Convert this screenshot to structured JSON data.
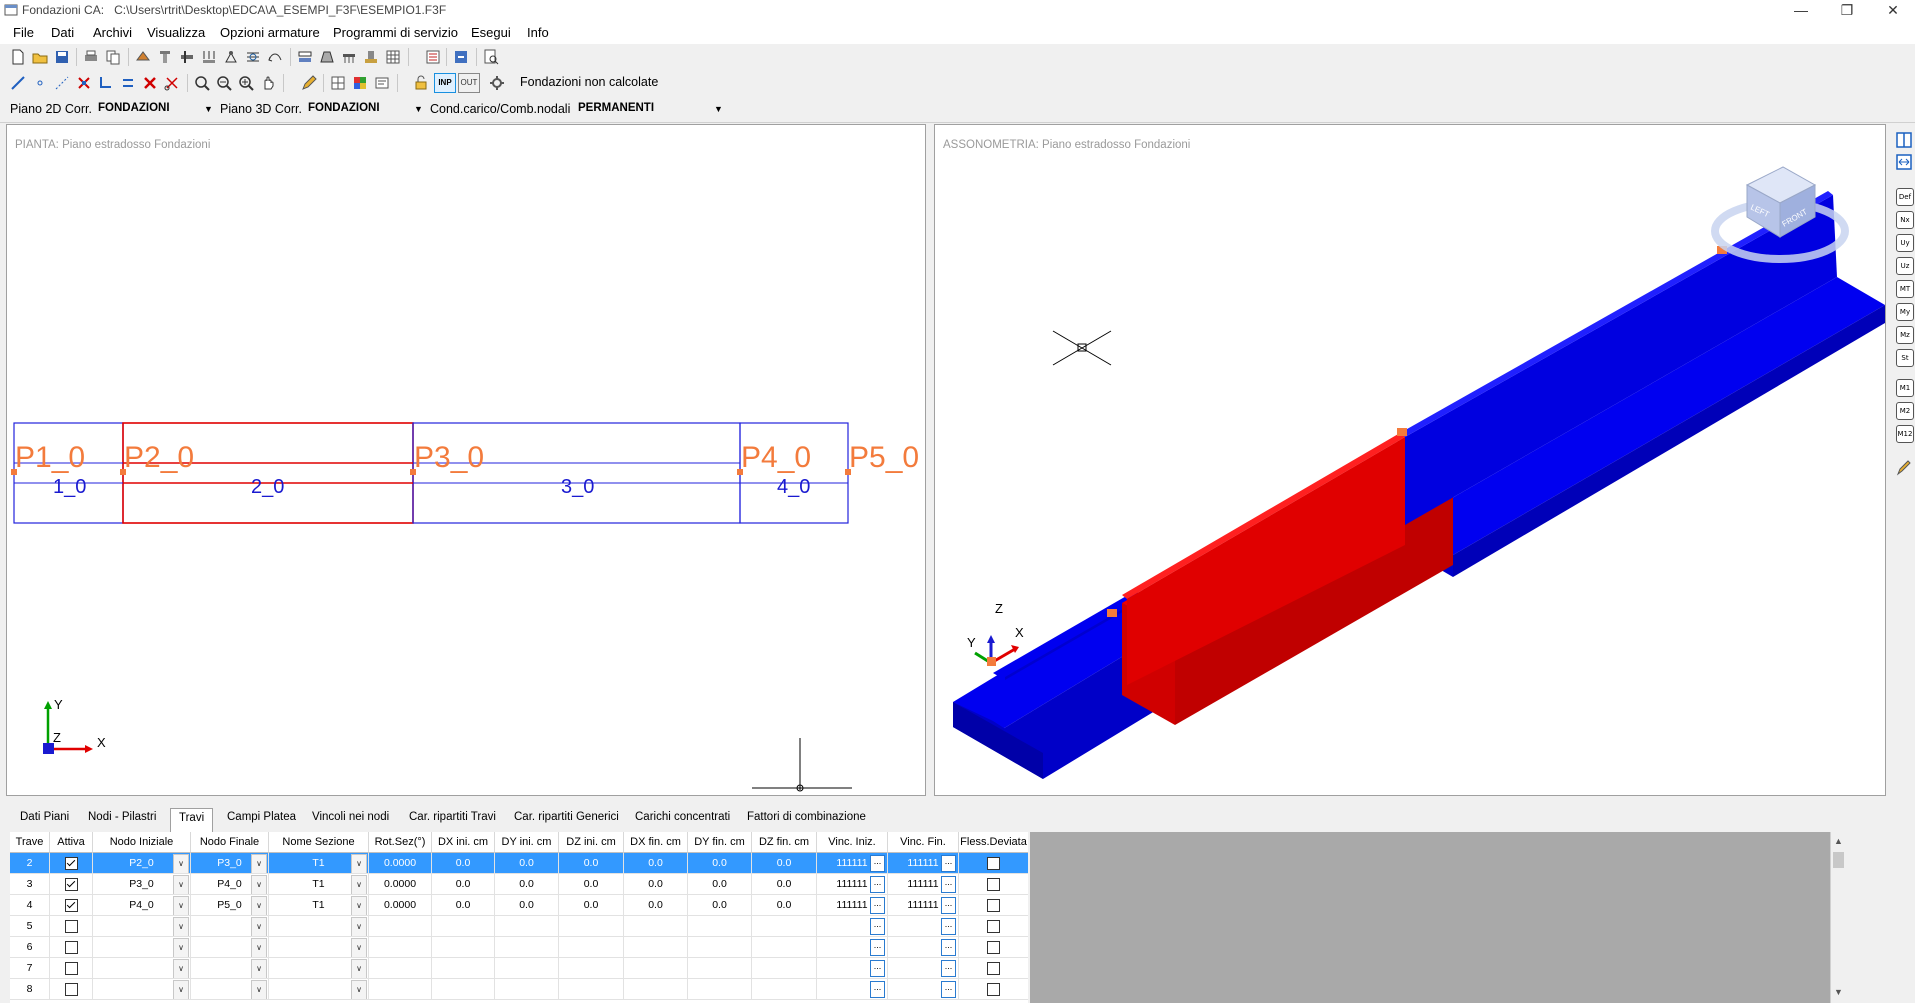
{
  "window": {
    "title": "Fondazioni CA:",
    "path": "C:\\Users\\rtrit\\Desktop\\EDCA\\A_ESEMPI_F3F\\ESEMPIO1.F3F",
    "controls": [
      "—",
      "❐",
      "✕"
    ]
  },
  "menu": [
    "File",
    "Dati",
    "Archivi",
    "Visualizza",
    "Opzioni armature",
    "Programmi di servizio",
    "Esegui",
    "Info"
  ],
  "toolbar2": {
    "status": "Fondazioni non calcolate",
    "inp": "INP",
    "out": "OUT"
  },
  "selectors": {
    "plane2d_label": "Piano 2D Corr.",
    "plane2d_value": "FONDAZIONI",
    "plane3d_label": "Piano 3D Corr.",
    "plane3d_value": "FONDAZIONI",
    "load_label": "Cond.carico/Comb.nodali",
    "load_value": "PERMANENTI"
  },
  "plan": {
    "caption": "PIANTA: Piano estradosso Fondazioni",
    "nodes": [
      "P1_0",
      "P2_0",
      "P3_0",
      "P4_0",
      "P5_0"
    ],
    "beams": [
      "1_0",
      "2_0",
      "3_0",
      "4_0"
    ],
    "axes": {
      "x": "X",
      "y": "Y",
      "z": "Z"
    }
  },
  "iso": {
    "caption": "ASSONOMETRIA: Piano estradosso Fondazioni",
    "cube_left": "LEFT",
    "cube_front": "FRONT",
    "axes": {
      "x": "X",
      "y": "Y",
      "z": "Z"
    }
  },
  "right_tools": [
    "Def",
    "Nx",
    "Uy",
    "Uz",
    "MT",
    "My",
    "Mz",
    "St",
    "M1",
    "M2",
    "M12"
  ],
  "tabs": [
    "Dati Piani",
    "Nodi - Pilastri",
    "Travi",
    "Campi Platea",
    "Vincoli nei nodi",
    "Car. ripartiti Travi",
    "Car. ripartiti Generici",
    "Carichi concentrati",
    "Fattori di combinazione"
  ],
  "active_tab": "Travi",
  "grid": {
    "headers": [
      "Trave",
      "Attiva",
      "Nodo Iniziale",
      "Nodo Finale",
      "Nome Sezione",
      "Rot.Sez(°)",
      "DX ini. cm",
      "DY ini. cm",
      "DZ ini. cm",
      "DX fin. cm",
      "DY fin. cm",
      "DZ fin. cm",
      "Vinc. Iniz.",
      "Vinc. Fin.",
      "Fless.Deviata"
    ],
    "rows": [
      {
        "trave": "2",
        "attiva": true,
        "nodo_ini": "P2_0",
        "nodo_fin": "P3_0",
        "sezione": "T1",
        "rot": "0.0000",
        "dxi": "0.0",
        "dyi": "0.0",
        "dzi": "0.0",
        "dxf": "0.0",
        "dyf": "0.0",
        "dzf": "0.0",
        "vi": "111111",
        "vf": "111111",
        "selected": true
      },
      {
        "trave": "3",
        "attiva": true,
        "nodo_ini": "P3_0",
        "nodo_fin": "P4_0",
        "sezione": "T1",
        "rot": "0.0000",
        "dxi": "0.0",
        "dyi": "0.0",
        "dzi": "0.0",
        "dxf": "0.0",
        "dyf": "0.0",
        "dzf": "0.0",
        "vi": "111111",
        "vf": "111111"
      },
      {
        "trave": "4",
        "attiva": true,
        "nodo_ini": "P4_0",
        "nodo_fin": "P5_0",
        "sezione": "T1",
        "rot": "0.0000",
        "dxi": "0.0",
        "dyi": "0.0",
        "dzi": "0.0",
        "dxf": "0.0",
        "dyf": "0.0",
        "dzf": "0.0",
        "vi": "111111",
        "vf": "111111"
      },
      {
        "trave": "5",
        "attiva": false
      },
      {
        "trave": "6",
        "attiva": false
      },
      {
        "trave": "7",
        "attiva": false
      },
      {
        "trave": "8",
        "attiva": false
      }
    ]
  },
  "colors": {
    "beam_blue": "#0000f0",
    "beam_red": "#f00000",
    "node_orange": "#f37b3c",
    "selection": "#3399ff"
  }
}
